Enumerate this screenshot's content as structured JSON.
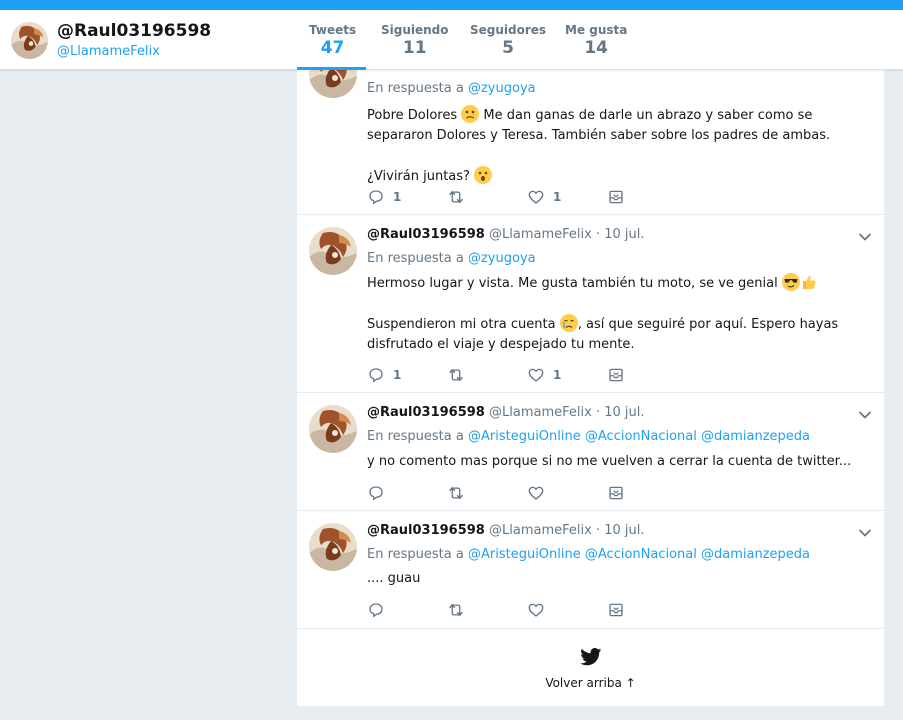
{
  "profile": {
    "name": "@Raul03196598",
    "handle": "@LlamameFelix"
  },
  "stats": [
    {
      "label": "Tweets",
      "value": "47"
    },
    {
      "label": "Siguiendo",
      "value": "11"
    },
    {
      "label": "Seguidores",
      "value": "5"
    },
    {
      "label": "Me gusta",
      "value": "14"
    }
  ],
  "colors": {
    "accent": "#1da1f2",
    "muted": "#657786",
    "background": "#e6ecf0"
  },
  "tweets": [
    {
      "reply_prefix": "En respuesta a",
      "mentions": [
        "@zyugoya"
      ],
      "text_a": "Pobre Dolores",
      "text_b": "Me dan ganas de darle un abrazo y saber como se separaron Dolores y Teresa. También saber sobre los padres de ambas.",
      "text_c": "¿Vivirán juntas?",
      "replies": "1",
      "likes": "1"
    },
    {
      "name": "@Raul03196598",
      "handle": "@LlamameFelix",
      "date": "· 10 jul.",
      "reply_prefix": "En respuesta a",
      "mentions": [
        "@zyugoya"
      ],
      "text_a": "Hermoso lugar y vista. Me gusta también tu moto, se ve genial",
      "text_b": "Suspendieron mi otra cuenta",
      "text_c": ", así que seguiré por aquí. Espero hayas disfrutado el viaje y despejado tu mente.",
      "replies": "1",
      "likes": "1"
    },
    {
      "name": "@Raul03196598",
      "handle": "@LlamameFelix",
      "date": "· 10 jul.",
      "reply_prefix": "En respuesta a",
      "mentions": [
        "@AristeguiOnline",
        "@AccionNacional",
        "@damianzepeda"
      ],
      "text_a": "y no comento mas porque si no me vuelven a cerrar la cuenta de twitter..."
    },
    {
      "name": "@Raul03196598",
      "handle": "@LlamameFelix",
      "date": "· 10 jul.",
      "reply_prefix": "En respuesta a",
      "mentions": [
        "@AristeguiOnline",
        "@AccionNacional",
        "@damianzepeda"
      ],
      "text_a": ".... guau"
    }
  ],
  "footer": {
    "back_to_top": "Volver arriba ↑"
  },
  "icons": [
    "reply-icon",
    "retweet-icon",
    "like-icon",
    "message-icon",
    "chevron-down-icon",
    "twitter-bird-icon"
  ]
}
